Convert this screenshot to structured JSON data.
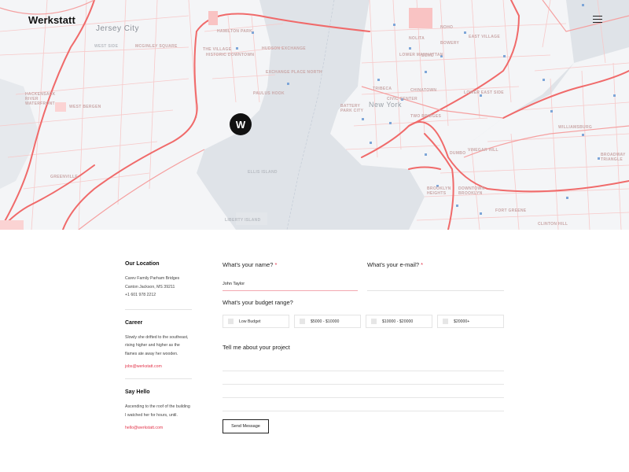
{
  "brand": "Werkstatt",
  "map": {
    "pin_letter": "W",
    "labels": {
      "jersey_city": "Jersey City",
      "new_york": "New York",
      "west_side": "WEST SIDE",
      "mcginley_square": "MCGINLEY SQUARE",
      "hamilton_park": "HAMILTON PARK",
      "the_village": "THE VILLAGE",
      "historic_downtown": "HISTORIC DOWNTOWN",
      "hudson_exchange": "HUDSON EXCHANGE",
      "exchange_place": "EXCHANGE PLACE NORTH",
      "paulus_hook": "PAULUS HOOK",
      "ellis_island": "ELLIS ISLAND",
      "liberty_island": "LIBERTY ISLAND",
      "hackensack": "HACKENSACK RIVER WATERFRONT",
      "west_bergen": "WEST BERGEN",
      "greenville": "GREENVILLE",
      "lower_manhattan": "LOWER MANHATTAN",
      "soho": "SOHO",
      "bowery": "BOWERY",
      "east_village": "EAST VILLAGE",
      "noho": "NOHO",
      "nolita": "NOLITA",
      "tribeca": "TRIBECA",
      "chinatown": "CHINATOWN",
      "lower_east_side": "LOWER EAST SIDE",
      "civic_center": "CIVIC CENTER",
      "two_bridges": "TWO BRIDGES",
      "battery_park": "BATTERY PARK CITY",
      "williamsburg": "WILLIAMSBURG",
      "dumbo": "DUMBO",
      "vinegar_hill": "VINEGAR HILL",
      "brooklyn_heights": "BROOKLYN HEIGHTS",
      "downtown_brooklyn": "DOWNTOWN BROOKLYN",
      "fort_greene": "FORT GREENE",
      "broadway_triangle": "BROADWAY TRIANGLE",
      "clinton_hill": "CLINTON HILL"
    }
  },
  "sidebar": {
    "location": {
      "title": "Our Location",
      "line1": "Carev Family Parham Bridges",
      "line2": "Canton  Jackson, MS 39211",
      "line3": "+1 601 978 2212"
    },
    "career": {
      "title": "Career",
      "text": "Slowly she drifted to the southeast, rising higher and higher as the flames ate away her wooden.",
      "email": "jobs@werkstatt.com"
    },
    "hello": {
      "title": "Say Hello",
      "text": "Ascending to the roof of the building I watched her for hours, until.",
      "email": "hello@werkstatt.com"
    }
  },
  "form": {
    "name_label": "What's your name?",
    "name_value": "John Taylor",
    "email_label": "What's your e-mail?",
    "email_value": "",
    "required_mark": "*",
    "budget_label": "What's your budget range?",
    "budget_options": [
      "Low Budget",
      "$5000 - $10000",
      "$10000 - $20000",
      "$20000+"
    ],
    "message_label": "Tell me about your project",
    "send_label": "Send Message"
  },
  "colors": {
    "accent": "#e2344a",
    "road": "#f06a6a",
    "map_bg": "#f4f5f7",
    "water": "#dfe3e8"
  }
}
